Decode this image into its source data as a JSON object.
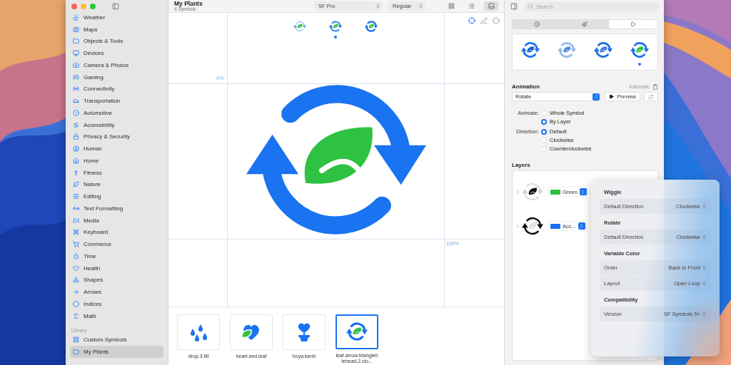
{
  "toolbar": {
    "title": "My Plants",
    "subtitle": "4 Symbols",
    "font": "SF Pro",
    "weight": "Regular",
    "view_modes": [
      {
        "kind": "grid",
        "selected": false
      },
      {
        "kind": "list",
        "selected": false
      },
      {
        "kind": "gallery",
        "selected": true
      }
    ],
    "search": {
      "placeholder": "Search"
    }
  },
  "sidebar": {
    "items": [
      {
        "label": "Weather",
        "kind": "weather",
        "selected": false
      },
      {
        "label": "Maps",
        "kind": "map",
        "selected": false
      },
      {
        "label": "Objects & Tools",
        "kind": "folder",
        "selected": false
      },
      {
        "label": "Devices",
        "kind": "monitor",
        "selected": false
      },
      {
        "label": "Camera & Photos",
        "kind": "camera",
        "selected": false
      },
      {
        "label": "Gaming",
        "kind": "gamepad",
        "selected": false
      },
      {
        "label": "Connectivity",
        "kind": "radio",
        "selected": false
      },
      {
        "label": "Transportation",
        "kind": "car",
        "selected": false
      },
      {
        "label": "Automotive",
        "kind": "wheel",
        "selected": false
      },
      {
        "label": "Accessibility",
        "kind": "accessibility",
        "selected": false
      },
      {
        "label": "Privacy & Security",
        "kind": "lock",
        "selected": false
      },
      {
        "label": "Human",
        "kind": "person",
        "selected": false
      },
      {
        "label": "Home",
        "kind": "house",
        "selected": false
      },
      {
        "label": "Fitness",
        "kind": "figure",
        "selected": false
      },
      {
        "label": "Nature",
        "kind": "leaf",
        "selected": false
      },
      {
        "label": "Editing",
        "kind": "sliders",
        "selected": false
      },
      {
        "label": "Text Formatting",
        "kind": "text",
        "selected": false
      },
      {
        "label": "Media",
        "kind": "media",
        "selected": false
      },
      {
        "label": "Keyboard",
        "kind": "command",
        "selected": false
      },
      {
        "label": "Commerce",
        "kind": "cart",
        "selected": false
      },
      {
        "label": "Time",
        "kind": "timer",
        "selected": false
      },
      {
        "label": "Health",
        "kind": "heart",
        "selected": false
      },
      {
        "label": "Shapes",
        "kind": "shapes",
        "selected": false
      },
      {
        "label": "Arrows",
        "kind": "arrow",
        "selected": false
      },
      {
        "label": "Indices",
        "kind": "circle",
        "selected": false
      },
      {
        "label": "Math",
        "kind": "sigma",
        "selected": false
      }
    ],
    "library_heading": "Library",
    "library": [
      {
        "label": "Custom Symbols",
        "kind": "grid",
        "selected": false
      },
      {
        "label": "My Plants",
        "kind": "folder",
        "selected": true
      }
    ]
  },
  "canvas": {
    "variants": [
      {
        "kind": "light",
        "selected": false
      },
      {
        "kind": "regular",
        "selected": true
      },
      {
        "kind": "bold",
        "selected": false
      }
    ],
    "guide_labels": [
      "0%",
      "100%"
    ]
  },
  "gallery": [
    {
      "name": "drop.3.fill",
      "kind": "drops",
      "selected": false
    },
    {
      "name": "heart.and.leaf",
      "kind": "heart-leaf",
      "selected": false
    },
    {
      "name": "hoya.kerrii",
      "kind": "potted-heart",
      "selected": false
    },
    {
      "name": "leaf.arrow.triangleh",
      "name_2": "lehead.2.clo...",
      "kind": "leaf-arrows",
      "selected": true
    }
  ],
  "inspector": {
    "tabs": [
      {
        "kind": "info",
        "selected": false
      },
      {
        "kind": "brush",
        "selected": false
      },
      {
        "kind": "play",
        "selected": true
      }
    ],
    "previews": [
      {
        "kind": "monochrome",
        "selected": false
      },
      {
        "kind": "hierarchical",
        "selected": false
      },
      {
        "kind": "palette",
        "selected": false
      },
      {
        "kind": "multicolor",
        "selected": true
      }
    ],
    "animation": {
      "heading": "Animation",
      "mode": "Automatic",
      "effect": "Rotate",
      "preview": "Preview"
    },
    "animate": {
      "label": "Animate:",
      "options": [
        {
          "label": "Whole Symbol",
          "selected": false
        },
        {
          "label": "By Layer",
          "selected": true
        }
      ]
    },
    "direction": {
      "label": "Direction:",
      "options": [
        {
          "label": "Default",
          "selected": true
        },
        {
          "label": "Clockwise",
          "selected": false
        },
        {
          "label": "Counterclockwise",
          "selected": false
        }
      ]
    },
    "layers": {
      "heading": "Layers",
      "items": [
        {
          "kind": "leaf",
          "name": "Green",
          "color": "#2fc142"
        },
        {
          "kind": "arrows",
          "name": "Acc...",
          "color": "#1a6ff0"
        }
      ]
    }
  },
  "popover": {
    "sections": [
      {
        "title": "Wiggle",
        "rows": [
          {
            "label": "Default Direction",
            "value": "Clockwise"
          }
        ]
      },
      {
        "title": "Rotate",
        "rows": [
          {
            "label": "Default Direction",
            "value": "Clockwise"
          }
        ]
      },
      {
        "title": "Variable Color",
        "rows": [
          {
            "label": "Order",
            "value": "Back to Front"
          },
          {
            "label": "Layout",
            "value": "Open Loop"
          }
        ]
      },
      {
        "title": "Compatibility",
        "rows": [
          {
            "label": "Version",
            "value": "SF Symbols 5+"
          }
        ]
      }
    ]
  }
}
